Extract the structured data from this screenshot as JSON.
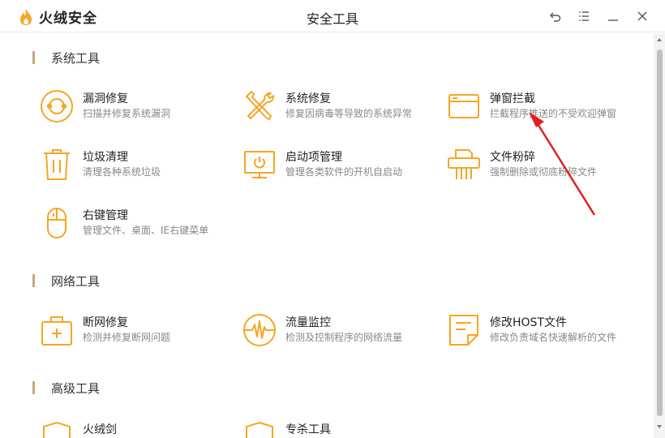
{
  "app": {
    "logo_text": "火绒安全",
    "window_title": "安全工具"
  },
  "window_controls": [
    "back-icon",
    "menu-icon",
    "minimize-icon",
    "close-icon"
  ],
  "accent_color": "#f5a623",
  "sections": [
    {
      "title": "系统工具",
      "tools": [
        {
          "name": "漏洞修复",
          "desc": "扫描并修复系统漏洞",
          "icon": "vulnerability-fix-icon"
        },
        {
          "name": "系统修复",
          "desc": "修复因病毒等导致的系统异常",
          "icon": "wrench-screwdriver-icon"
        },
        {
          "name": "弹窗拦截",
          "desc": "拦截程序推送的不受欢迎弹窗",
          "icon": "popup-window-icon"
        },
        {
          "name": "垃圾清理",
          "desc": "清理各种系统垃圾",
          "icon": "trash-bin-icon"
        },
        {
          "name": "启动项管理",
          "desc": "管理各类软件的开机自启动",
          "icon": "monitor-power-icon"
        },
        {
          "name": "文件粉碎",
          "desc": "强制删除或彻底粉碎文件",
          "icon": "shredder-icon"
        },
        {
          "name": "右键管理",
          "desc": "管理文件、桌面、IE右键菜单",
          "icon": "mouse-icon"
        }
      ]
    },
    {
      "title": "网络工具",
      "tools": [
        {
          "name": "断网修复",
          "desc": "检测并修复断网问题",
          "icon": "first-aid-kit-icon"
        },
        {
          "name": "流量监控",
          "desc": "检测及控制程序的网络流量",
          "icon": "traffic-wave-icon"
        },
        {
          "name": "修改HOST文件",
          "desc": "修改负责域名快速解析的文件",
          "icon": "host-file-icon"
        }
      ]
    },
    {
      "title": "高级工具",
      "tools": [
        {
          "name": "火绒剑",
          "desc": "",
          "icon": "shield-icon"
        },
        {
          "name": "专杀工具",
          "desc": "",
          "icon": "shield-icon"
        }
      ]
    }
  ]
}
